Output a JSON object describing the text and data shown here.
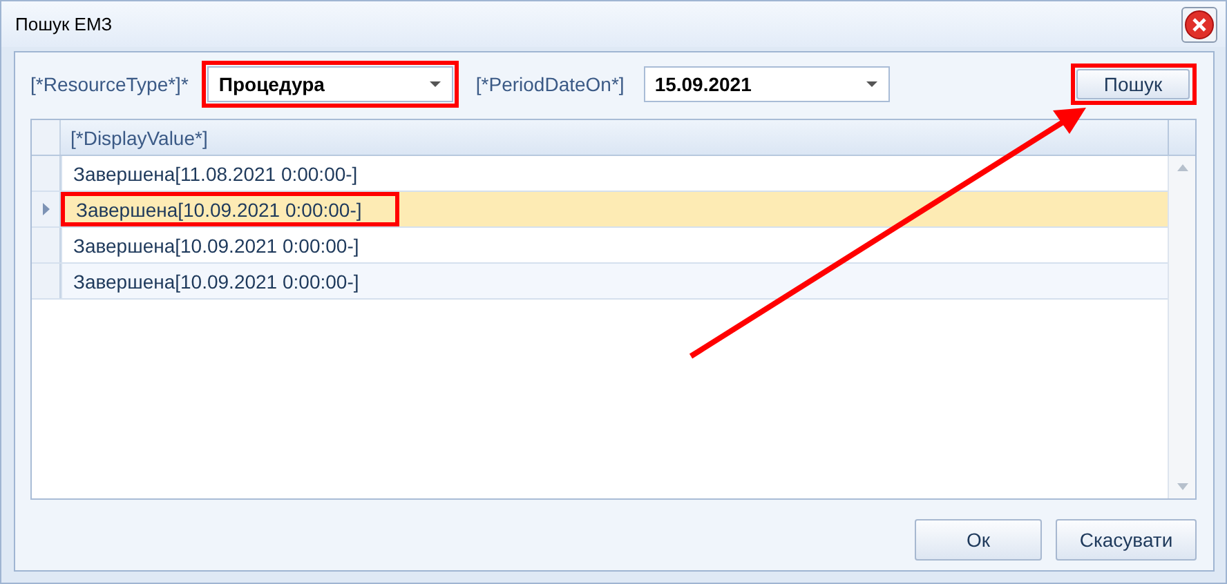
{
  "window": {
    "title": "Пошук ЕМЗ"
  },
  "filters": [
    {
      "label": "[*ResourceType*]*",
      "value": "Процедура",
      "highlighted": true
    },
    {
      "label": "[*PeriodDateOn*]",
      "value": "15.09.2021",
      "highlighted": false
    }
  ],
  "search_button": {
    "label": "Пошук",
    "highlighted": true
  },
  "table": {
    "columns": [
      "[*DisplayValue*]"
    ],
    "rows": [
      {
        "value": "Завершена[11.08.2021 0:00:00-]",
        "selected": false,
        "highlighted": false
      },
      {
        "value": "Завершена[10.09.2021 0:00:00-]",
        "selected": true,
        "highlighted": true
      },
      {
        "value": "Завершена[10.09.2021 0:00:00-]",
        "selected": false,
        "highlighted": false
      },
      {
        "value": "Завершена[10.09.2021 0:00:00-]",
        "selected": false,
        "highlighted": false
      }
    ]
  },
  "buttons": [
    "Ок",
    "Скасувати"
  ]
}
